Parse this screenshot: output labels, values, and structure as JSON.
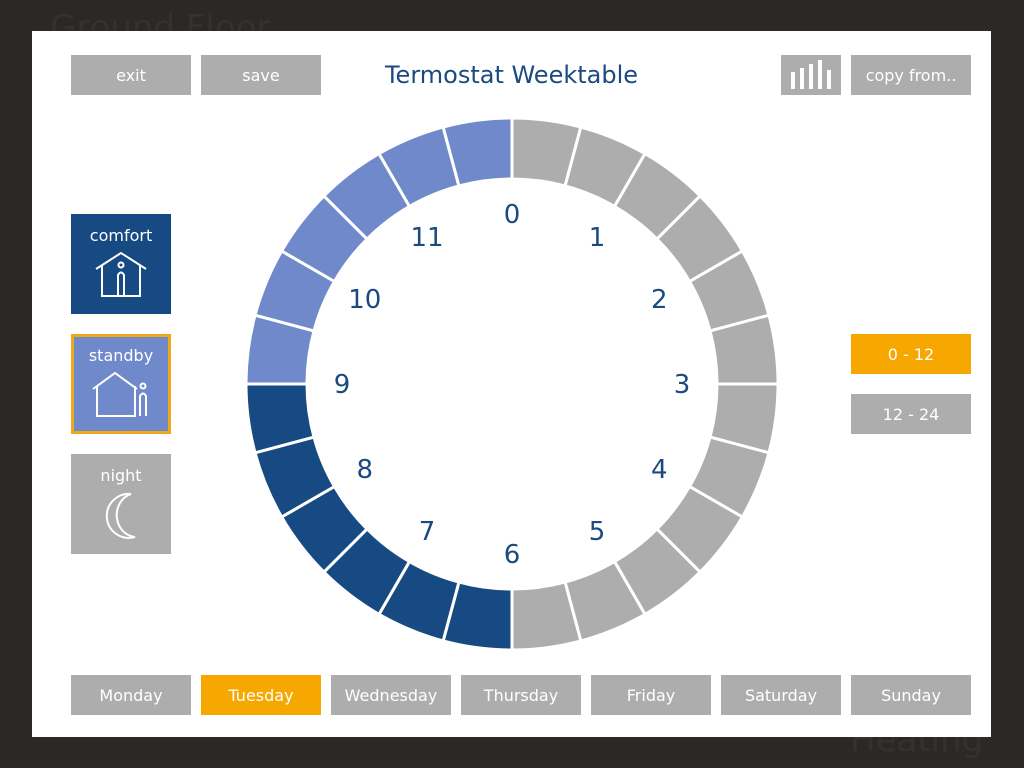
{
  "background": {
    "title": "Ground Floor",
    "subtitle": "Heating"
  },
  "header": {
    "title": "Termostat Weektable",
    "exit_label": "exit",
    "save_label": "save",
    "copy_label": "copy from..",
    "chart_icon": "bar-chart-icon"
  },
  "modes": [
    {
      "label": "comfort",
      "icon": "house-person-inside-icon",
      "color": "#174a82"
    },
    {
      "label": "standby",
      "icon": "house-person-outside-icon",
      "color": "#7089cb",
      "selected": true
    },
    {
      "label": "night",
      "icon": "moon-icon",
      "color": "#adadad"
    }
  ],
  "ranges": [
    {
      "label": "0 - 12",
      "active": true
    },
    {
      "label": "12 - 24",
      "active": false
    }
  ],
  "days": [
    {
      "label": "Monday"
    },
    {
      "label": "Tuesday",
      "active": true
    },
    {
      "label": "Wednesday"
    },
    {
      "label": "Thursday"
    },
    {
      "label": "Friday"
    },
    {
      "label": "Saturday"
    },
    {
      "label": "Sunday"
    }
  ],
  "clock": {
    "hours": [
      "0",
      "1",
      "2",
      "3",
      "4",
      "5",
      "6",
      "7",
      "8",
      "9",
      "10",
      "11"
    ],
    "segments": [
      "night",
      "night",
      "night",
      "night",
      "night",
      "night",
      "night",
      "night",
      "night",
      "night",
      "night",
      "night",
      "comfort",
      "comfort",
      "comfort",
      "comfort",
      "comfort",
      "comfort",
      "standby",
      "standby",
      "standby",
      "standby",
      "standby",
      "standby"
    ]
  },
  "colors": {
    "comfort": "#174a82",
    "standby": "#7089cb",
    "night": "#adadad",
    "accent": "#f7a800",
    "text": "#1a4a80"
  }
}
